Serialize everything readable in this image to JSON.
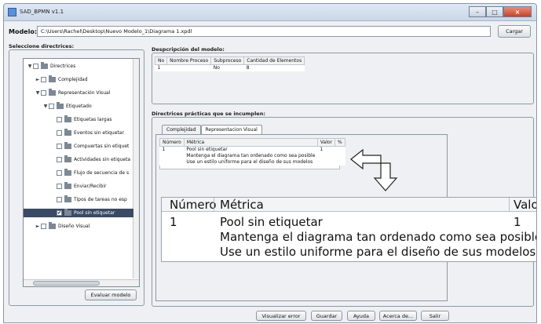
{
  "window": {
    "title": "SAD_BPMN v1.1",
    "close_glyph": "×",
    "minimize_glyph": "–",
    "maximize_glyph": "□"
  },
  "modelo": {
    "label": "Modelo:",
    "path": "C:\\Users\\Rachel\\Desktop\\Nuevo Modelo_1\\Diagrama 1.xpdl",
    "load_label": "Cargar"
  },
  "sidebar": {
    "title": "Seleccione directrices:",
    "evaluate_label": "Evaluar modelo",
    "tree": [
      {
        "label": "Directrices",
        "caret": "▼",
        "checked": ""
      },
      {
        "label": "Complejidad",
        "caret": "►",
        "checked": ""
      },
      {
        "label": "Representación Visual",
        "caret": "▼",
        "checked": ""
      },
      {
        "label": "Etiquetado",
        "caret": "▼",
        "checked": ""
      },
      {
        "label": "Etiquetas largas",
        "caret": "",
        "checked": ""
      },
      {
        "label": "Eventos sin etiquetar",
        "caret": "",
        "checked": ""
      },
      {
        "label": "Compuertas sin etiquet",
        "caret": "",
        "checked": ""
      },
      {
        "label": "Actividades sin etiqueta",
        "caret": "",
        "checked": ""
      },
      {
        "label": "Flujo de secuencia de s",
        "caret": "",
        "checked": ""
      },
      {
        "label": "Enviar/Recibir",
        "caret": "",
        "checked": ""
      },
      {
        "label": "Tipos de tareas no esp",
        "caret": "",
        "checked": ""
      },
      {
        "label": "Pool sin etiquetar",
        "caret": "",
        "checked": "✔"
      },
      {
        "label": "Diseño Visual",
        "caret": "►",
        "checked": ""
      }
    ]
  },
  "description": {
    "title": "Despcripción del modelo:",
    "headers": [
      "No",
      "Nombre Proceso",
      "Subproceso",
      "Cantidad de Elementos"
    ],
    "row": [
      "1",
      "",
      "No",
      "8"
    ]
  },
  "practices": {
    "title": "Directrices prácticas que se incumplen:",
    "tabs": [
      "Complejidad",
      "Representacion Visual"
    ],
    "headers": [
      "Número",
      "Métrica",
      "Valor",
      "%"
    ],
    "rows": [
      {
        "num": "1",
        "metric": "Pool sin etiquetar",
        "value": "1"
      },
      {
        "num": "",
        "metric": "Mantenga el diagrama tan ordenado como sea posible",
        "value": ""
      },
      {
        "num": "",
        "metric": "Use un estilo uniforme para el diseño de sus modelos",
        "value": ""
      }
    ]
  },
  "footer": {
    "buttons": [
      "Visualizar error",
      "Guardar",
      "Ayuda",
      "Acerca de...",
      "Salir"
    ]
  }
}
